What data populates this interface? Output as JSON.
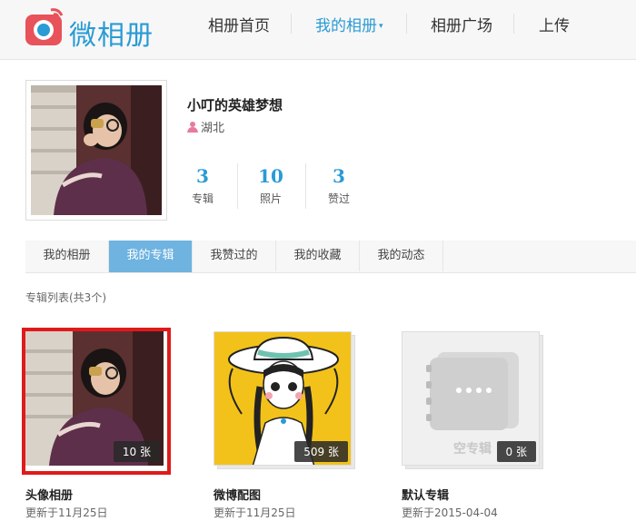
{
  "header": {
    "logo_text": "微相册",
    "nav": [
      {
        "label": "相册首页",
        "active": false
      },
      {
        "label": "我的相册",
        "active": true
      },
      {
        "label": "相册广场",
        "active": false
      },
      {
        "label": "上传",
        "active": false
      }
    ]
  },
  "profile": {
    "name": "小叮的英雄梦想",
    "location": "湖北",
    "stats": [
      {
        "value": "3",
        "label": "专辑"
      },
      {
        "value": "10",
        "label": "照片"
      },
      {
        "value": "3",
        "label": "赞过"
      }
    ]
  },
  "tabs": [
    {
      "label": "我的相册",
      "active": false
    },
    {
      "label": "我的专辑",
      "active": true
    },
    {
      "label": "我赞过的",
      "active": false
    },
    {
      "label": "我的收藏",
      "active": false
    },
    {
      "label": "我的动态",
      "active": false
    }
  ],
  "album_list_title": "专辑列表(共3个)",
  "albums": [
    {
      "name": "头像相册",
      "count": "10 张",
      "updated": "更新于11月25日",
      "selected": true
    },
    {
      "name": "微博配图",
      "count": "509 张",
      "updated": "更新于11月25日",
      "selected": false
    },
    {
      "name": "默认专辑",
      "count": "0 张",
      "updated": "更新于2015-04-04",
      "selected": false,
      "empty_label": "空专辑"
    }
  ],
  "colors": {
    "accent": "#2a9bd5",
    "tab_active": "#6fb3e0",
    "selected_border": "#e01a1a"
  }
}
